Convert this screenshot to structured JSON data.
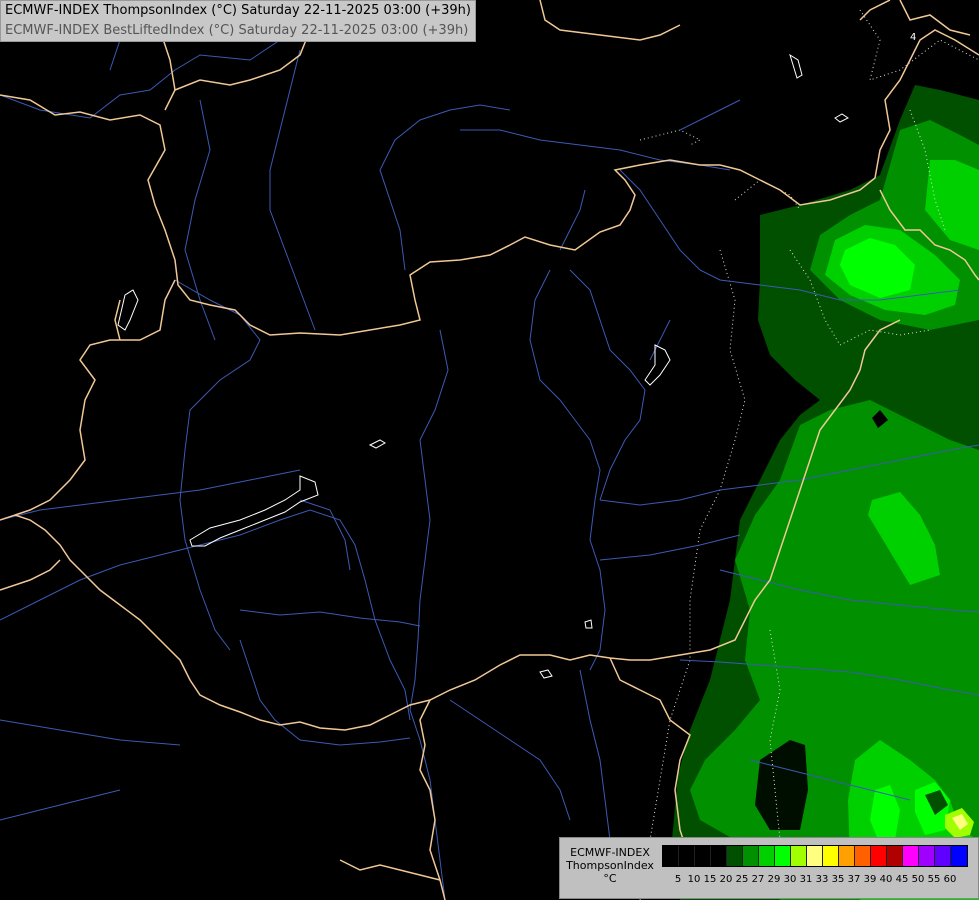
{
  "titles": {
    "line1": "ECMWF-INDEX ThompsonIndex (°C) Saturday 22-11-2025 03:00 (+39h)",
    "line2": "ECMWF-INDEX BestLiftedIndex (°C) Saturday 22-11-2025 03:00 (+39h)"
  },
  "legend": {
    "line1": "ECMWF-INDEX",
    "line2": "ThompsonIndex",
    "unit": "°C",
    "ticks": [
      "5",
      "10",
      "15",
      "20",
      "25",
      "27",
      "29",
      "30",
      "31",
      "33",
      "35",
      "37",
      "39",
      "40",
      "45",
      "50",
      "55",
      "60"
    ],
    "colors": [
      "#000000",
      "#000000",
      "#000000",
      "#000000",
      "#005000",
      "#009000",
      "#00d000",
      "#00ff00",
      "#a0ff00",
      "#ffff80",
      "#ffff00",
      "#ffa000",
      "#ff6000",
      "#ff0000",
      "#b00000",
      "#ff00ff",
      "#a000ff",
      "#6000ff",
      "#0000ff"
    ]
  },
  "map_colors": {
    "background": "#000000",
    "borders": "#f0c896",
    "rivers": "#3c5ab4",
    "lakes": "#ffffff"
  },
  "map_labels": {
    "contour_label": "4"
  }
}
